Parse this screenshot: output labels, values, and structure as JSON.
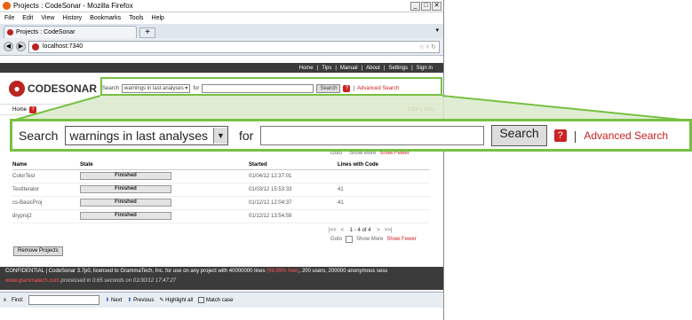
{
  "window": {
    "title": "Projects : CodeSonar - Mozilla Firefox",
    "controls": [
      "_",
      "□",
      "✕"
    ]
  },
  "menu": [
    "File",
    "Edit",
    "View",
    "History",
    "Bookmarks",
    "Tools",
    "Help"
  ],
  "tab": {
    "label": "Projects : CodeSonar",
    "newtab": "+"
  },
  "url": "localhost:7340",
  "sitenav": [
    "Home",
    "|",
    "Tips",
    "|",
    "Manual",
    "|",
    "About",
    "|",
    "Settings",
    "|",
    "Sign in"
  ],
  "logo": "CODESONAR",
  "search": {
    "label": "Search",
    "selected": "warnings in last analyses",
    "for": "for",
    "button": "Search",
    "help": "?",
    "sep": "|",
    "advanced": "Advanced Search"
  },
  "homebar": {
    "home": "Home",
    "csv": "CSV",
    "sep": "|",
    "xml": "XML"
  },
  "goto": {
    "label": "Goto",
    "show_more": "Show More",
    "show_fewer": "Show Fewer"
  },
  "table": {
    "headers": [
      "Name",
      "State",
      "Started",
      "Lines with Code"
    ],
    "rows": [
      {
        "name": "ColorTest",
        "state": "Finished",
        "started": "01/04/12 12:37:01",
        "lines": ""
      },
      {
        "name": "TestIterator",
        "state": "Finished",
        "started": "01/03/12 15:53:33",
        "lines": "41"
      },
      {
        "name": "cs-BasicProj",
        "state": "Finished",
        "started": "01/12/12 12:04:37",
        "lines": "41"
      },
      {
        "name": "dryproj2",
        "state": "Finished",
        "started": "01/12/12 13:54:59",
        "lines": ""
      }
    ]
  },
  "pager": {
    "first": "|<<",
    "prev": "<",
    "range": "1 - 4 of 4",
    "next": ">",
    "last": ">>|"
  },
  "remove_button": "Remove Projects",
  "footer": {
    "line1_a": "CONFIDENTIAL | CodeSonar 3.7p0, licensed to GrammaTech, Inc. for use on any project with 40000000 lines ",
    "line1_red": "(99.99% free)",
    "line1_b": ", 200 users, 200000 anonymous sess",
    "line2_a": "www.grammatech.com",
    "line2_b": "   processed in 0.65 seconds on 01/30/12 17:47:27"
  },
  "findbar": {
    "close": "x",
    "label": "Find:",
    "next": "Next",
    "previous": "Previous",
    "highlight": "Highlight all",
    "matchcase": "Match case"
  }
}
